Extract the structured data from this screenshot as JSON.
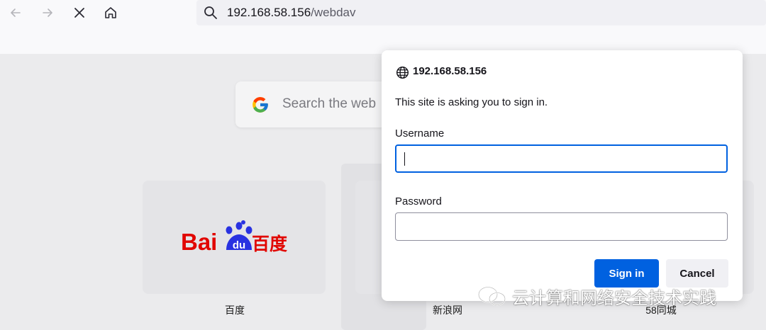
{
  "toolbar": {
    "url_host": "192.168.58.156",
    "url_path": "/webdav",
    "icons": [
      "back-icon",
      "forward-icon",
      "stop-icon",
      "home-icon",
      "search-icon"
    ]
  },
  "newtab": {
    "search_placeholder": "Search the web",
    "tiles": [
      {
        "label": "百度",
        "logo_text": "Bai",
        "logo_badge": "du",
        "logo_cn": "百度"
      },
      {
        "label": "新浪网"
      },
      {
        "label": "58同城"
      }
    ]
  },
  "dialog": {
    "host": "192.168.58.156",
    "message": "This site is asking you to sign in.",
    "username_label": "Username",
    "username_value": "",
    "password_label": "Password",
    "password_value": "",
    "sign_in_label": "Sign in",
    "cancel_label": "Cancel"
  },
  "watermark": {
    "text": "云计算和网络安全技术实践"
  },
  "colors": {
    "accent": "#0061e0",
    "toolbar_bg": "#f9f9fb",
    "content_overlay": "#ebebed",
    "baidu_red": "#e10601",
    "baidu_blue": "#2932e1"
  }
}
